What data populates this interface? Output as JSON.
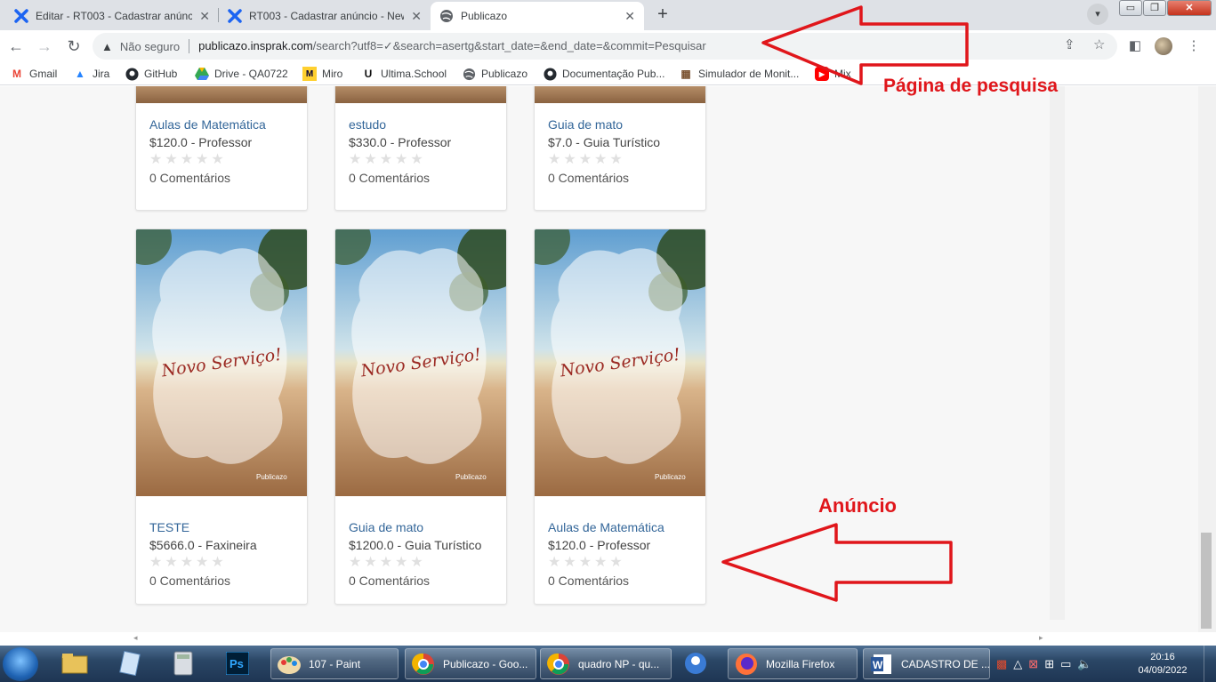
{
  "tabs": [
    {
      "title": "Editar - RT003 - Cadastrar anúncio",
      "close": "✕"
    },
    {
      "title": "RT003 - Cadastrar anúncio - New",
      "close": "✕"
    },
    {
      "title": "Publicazo",
      "close": "✕"
    }
  ],
  "newtab": "+",
  "window_buttons": {
    "minimize": "▭",
    "restore": "❐",
    "close": "✕"
  },
  "omnibox": {
    "warning": "▲",
    "security": "Não seguro",
    "host": "publicazo.insprak.com",
    "path": "/search?utf8=✓&search=asertg&start_date=&end_date=&commit=Pesquisar"
  },
  "bookmarks": [
    {
      "label": "Gmail",
      "icon": "gmail-icon"
    },
    {
      "label": "Jira",
      "icon": "jira-icon"
    },
    {
      "label": "GitHub",
      "icon": "github-icon"
    },
    {
      "label": "Drive - QA0722",
      "icon": "drive-icon"
    },
    {
      "label": "Miro",
      "icon": "miro-icon"
    },
    {
      "label": "Ultima.School",
      "icon": "ultima-icon"
    },
    {
      "label": "Publicazo",
      "icon": "globe-icon"
    },
    {
      "label": "Documentação Pub...",
      "icon": "github-icon"
    },
    {
      "label": "Simulador de Monit...",
      "icon": "simulator-icon"
    },
    {
      "label": "Mix",
      "icon": "youtube-icon"
    }
  ],
  "cards_top": [
    {
      "title": "Aulas de Matemática",
      "price": "$120.0 - Professor",
      "stars": "★★★★★",
      "comments": "0 Comentários"
    },
    {
      "title": "estudo",
      "price": "$330.0 - Professor",
      "stars": "★★★★★",
      "comments": "0 Comentários"
    },
    {
      "title": "Guia de mato",
      "price": "$7.0 - Guia Turístico",
      "stars": "★★★★★",
      "comments": "0 Comentários"
    }
  ],
  "cards_bottom": [
    {
      "title": "TESTE",
      "price": "$5666.0 - Faxineira",
      "stars": "★★★★★",
      "comments": "0 Comentários",
      "image_text": "Novo Serviço!",
      "image_brand": "Publicazo"
    },
    {
      "title": "Guia de mato",
      "price": "$1200.0 - Guia Turístico",
      "stars": "★★★★★",
      "comments": "0 Comentários",
      "image_text": "Novo Serviço!",
      "image_brand": "Publicazo"
    },
    {
      "title": "Aulas de Matemática",
      "price": "$120.0 - Professor",
      "stars": "★★★★★",
      "comments": "0 Comentários",
      "image_text": "Novo Serviço!",
      "image_brand": "Publicazo"
    }
  ],
  "annotations": {
    "search_page": "Página de pesquisa",
    "ad": "Anúncio",
    "color": "#e0161b"
  },
  "taskbar": {
    "buttons": [
      {
        "label": "107 - Paint",
        "icon": "paint-icon"
      },
      {
        "label": "Publicazo - Goo...",
        "icon": "chrome-icon"
      },
      {
        "label": "quadro NP - qu...",
        "icon": "chrome-icon"
      },
      {
        "label": "Mozilla Firefox",
        "icon": "firefox-icon"
      },
      {
        "label": "CADASTRO DE ...",
        "icon": "word-icon"
      }
    ],
    "time": "20:16",
    "date": "04/09/2022"
  }
}
